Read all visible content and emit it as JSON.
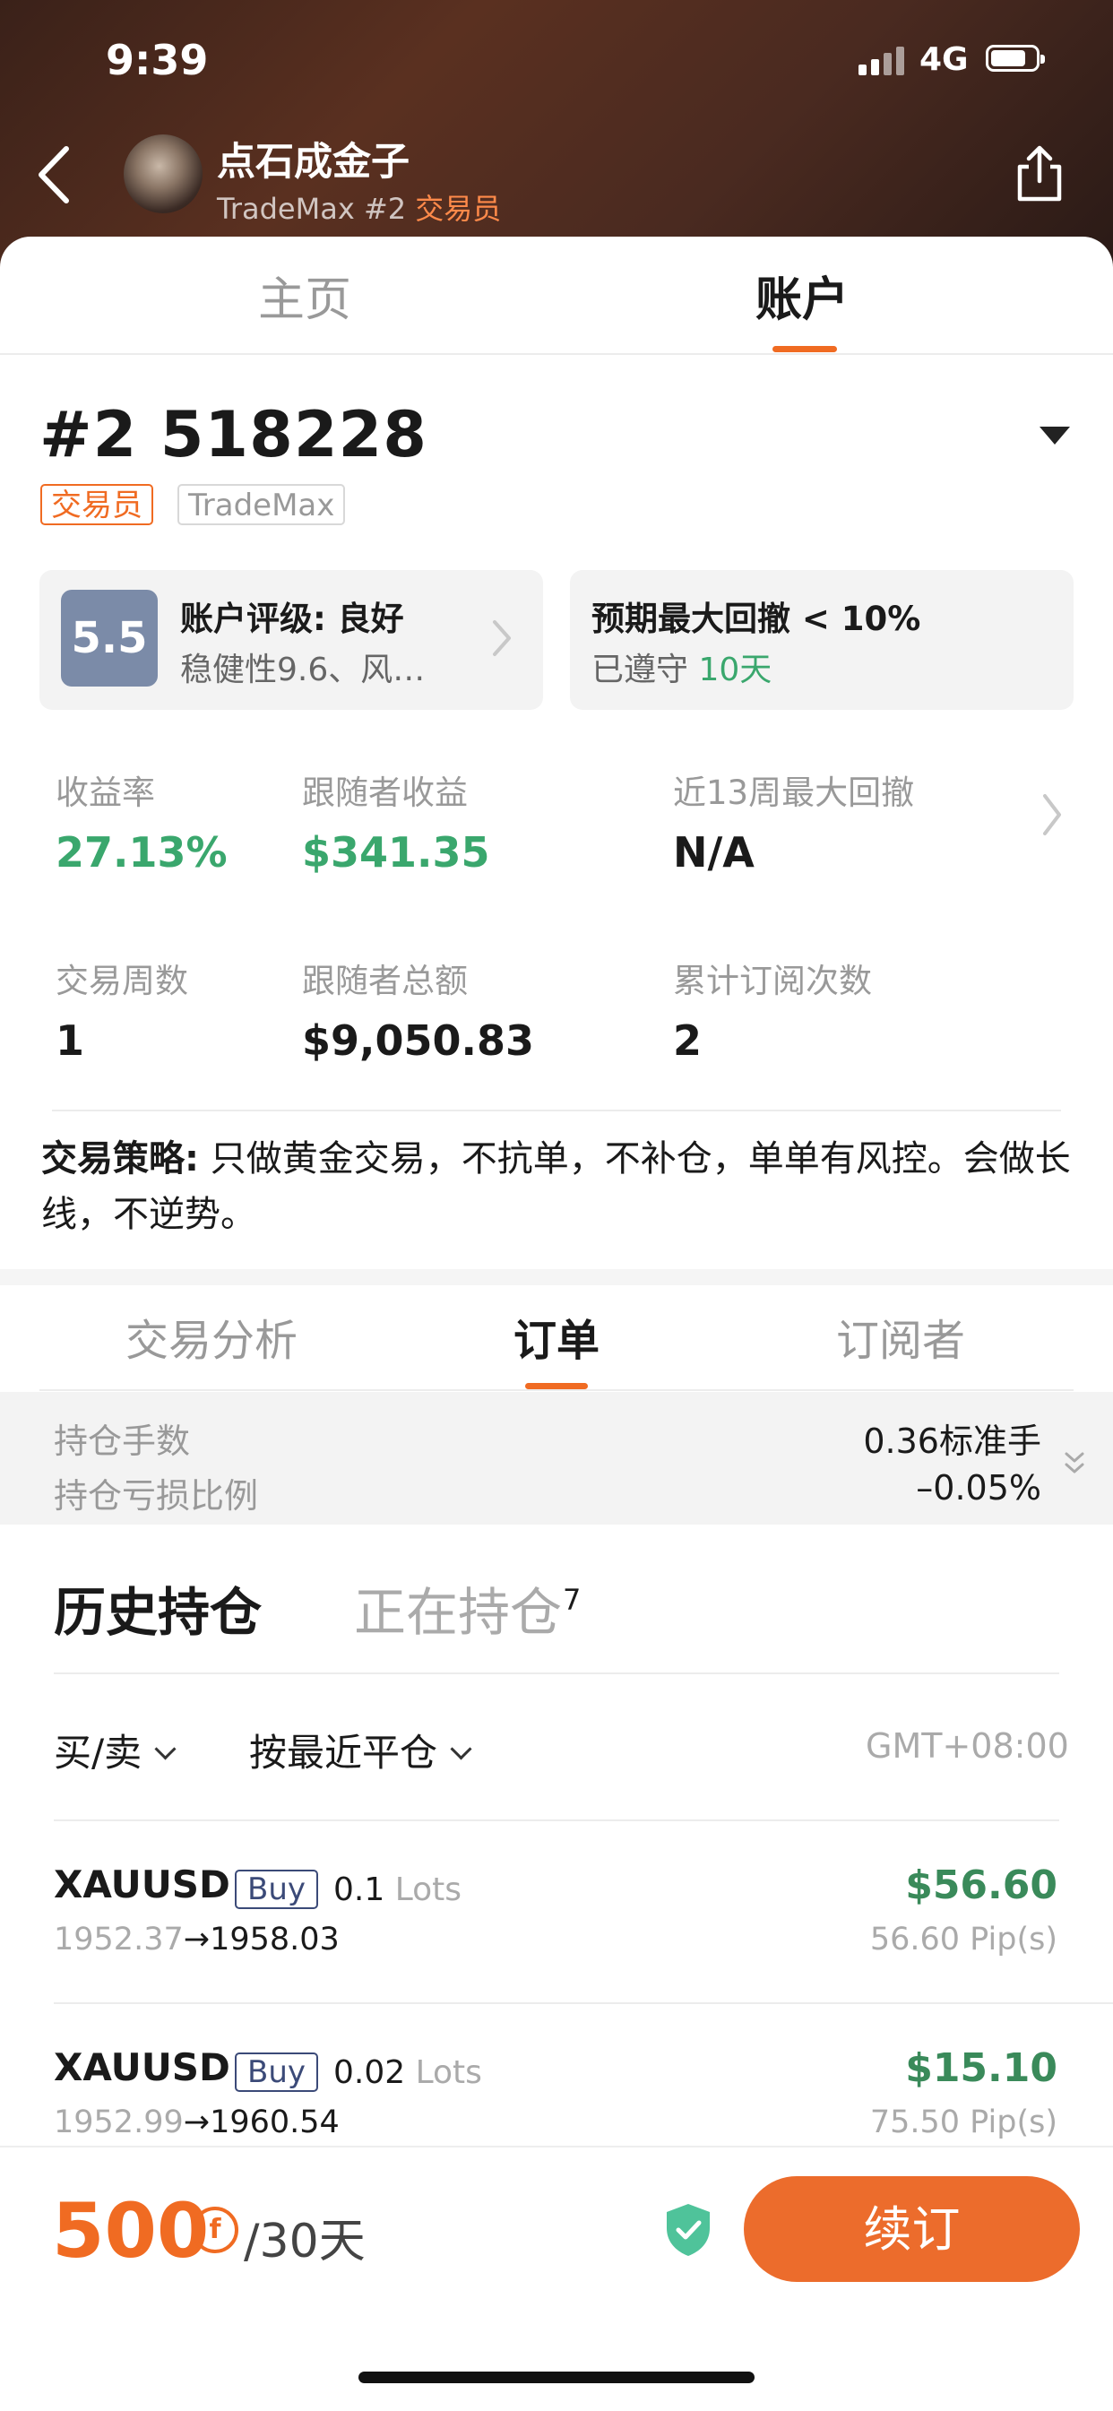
{
  "status_bar": {
    "time": "9:39",
    "network": "4G"
  },
  "header": {
    "nickname": "点石成金子",
    "platform_account": "TradeMax #2",
    "role": "交易员",
    "icons": {
      "back": "back-arrow-icon",
      "share": "share-icon"
    }
  },
  "main_tabs": [
    {
      "label": "主页",
      "active": false
    },
    {
      "label": "账户",
      "active": true
    }
  ],
  "account": {
    "id": "#2 518228",
    "badges": [
      "交易员",
      "TradeMax"
    ]
  },
  "rating_card": {
    "score": "5.5",
    "title": "账户评级: 良好",
    "detail": "稳健性9.6、风…"
  },
  "drawdown_card": {
    "title": "预期最大回撤 < 10%",
    "compliance_prefix": "已遵守",
    "compliance_days": "10天"
  },
  "stats": {
    "return_rate": {
      "label": "收益率",
      "value": "27.13%"
    },
    "follower_profit": {
      "label": "跟随者收益",
      "value": "$341.35"
    },
    "max_drawdown_13w": {
      "label": "近13周最大回撤",
      "value": "N/A"
    },
    "trading_weeks": {
      "label": "交易周数",
      "value": "1"
    },
    "follower_total": {
      "label": "跟随者总额",
      "value": "$9,050.83"
    },
    "total_subscriptions": {
      "label": "累计订阅次数",
      "value": "2"
    }
  },
  "strategy": {
    "label": "交易策略:",
    "text": " 只做黄金交易，不抗单，不补仓，单单有风控。会做长线，不逆势。"
  },
  "sub_tabs": [
    {
      "label": "交易分析",
      "active": false
    },
    {
      "label": "订单",
      "active": true
    },
    {
      "label": "订阅者",
      "active": false
    }
  ],
  "position_summary": {
    "lots_label": "持仓手数",
    "lots_value": "0.36标准手",
    "pnl_ratio_label": "持仓亏损比例",
    "pnl_ratio_value": "–0.05%"
  },
  "history_tabs": {
    "history": "历史持仓",
    "open": "正在持仓",
    "open_count": "7"
  },
  "filters": {
    "side": "买/卖",
    "sort": "按最近平仓",
    "timezone": "GMT+08:00"
  },
  "orders": [
    {
      "symbol": "XAUUSD",
      "side": "Buy",
      "lots": "0.1",
      "lots_unit": "Lots",
      "open": "1952.37",
      "arrow": "→",
      "close": "1958.03",
      "profit": "$56.60",
      "pips": "56.60 Pip(s)"
    },
    {
      "symbol": "XAUUSD",
      "side": "Buy",
      "lots": "0.02",
      "lots_unit": "Lots",
      "open": "1952.99",
      "arrow": "→",
      "close": "1960.54",
      "profit": "$15.10",
      "pips": "75.50 Pip(s)"
    }
  ],
  "footer": {
    "price": "500",
    "currency_symbol": "f",
    "period": "/30天",
    "renew_label": "续订"
  },
  "colors": {
    "accent": "#f06b22",
    "profit_green": "#3aa76d",
    "order_profit_green": "#3a8a5a",
    "score_badge": "#7b8ba8",
    "buy_tag": "#3b4a78"
  }
}
